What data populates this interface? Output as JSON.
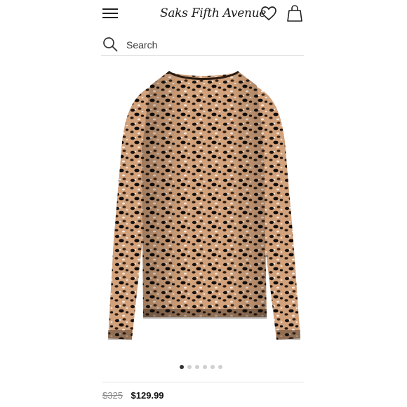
{
  "header": {
    "logo_text": "Saks Fifth Avenue",
    "menu_icon": "hamburger-icon",
    "wishlist_icon": "heart-icon",
    "bag_icon": "shopping-bag-icon"
  },
  "search": {
    "placeholder": "Search",
    "icon": "search-icon"
  },
  "product": {
    "image_description_icon": "leopard-print-sweater-image",
    "carousel": {
      "total": 6,
      "active_index": 0
    },
    "original_price": "$325",
    "sale_price": "$129.99"
  },
  "colors": {
    "accent": "#111111",
    "muted": "#888888",
    "dot_inactive": "#cfcfcf",
    "dot_active": "#333333"
  }
}
